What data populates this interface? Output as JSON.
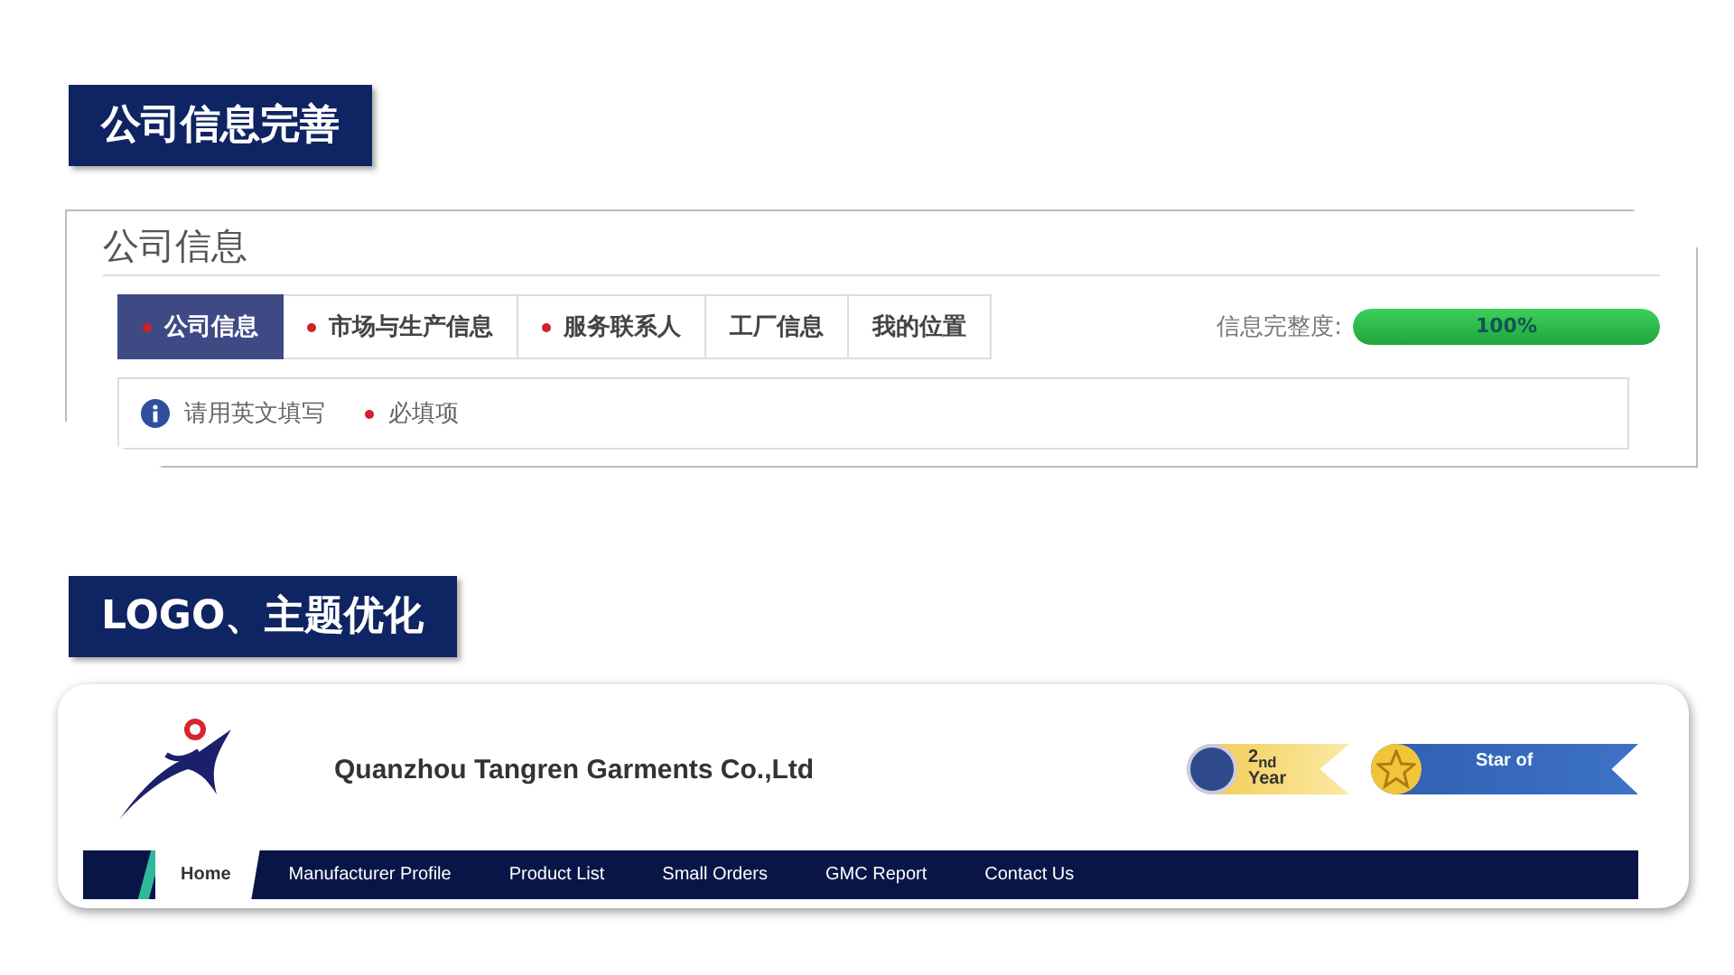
{
  "sections": [
    {
      "heading": "公司信息完善"
    },
    {
      "heading": "LOGO、主题优化"
    }
  ],
  "company_info": {
    "title": "公司信息",
    "tabs": [
      {
        "label": "公司信息",
        "required": true,
        "selected": true
      },
      {
        "label": "市场与生产信息",
        "required": true,
        "selected": false
      },
      {
        "label": "服务联系人",
        "required": true,
        "selected": false
      },
      {
        "label": "工厂信息",
        "required": false,
        "selected": false
      },
      {
        "label": "我的位置",
        "required": false,
        "selected": false
      }
    ],
    "completeness": {
      "label": "信息完整度:",
      "level": 1,
      "reading": "100%"
    },
    "notes": [
      {
        "kind": "info",
        "text": "请用英文填写"
      },
      {
        "kind": "required",
        "text": "必填项"
      }
    ]
  },
  "storefront": {
    "company_name": "Quanzhou Tangren Garments Co.,Ltd",
    "badges": [
      {
        "kind": "year",
        "text": "2$_{nd}$ Year"
      },
      {
        "kind": "star",
        "text": "Star of"
      }
    ],
    "nav": [
      {
        "label": "Home",
        "selected": true
      },
      {
        "label": "Manufacturer Profile",
        "selected": false
      },
      {
        "label": "Product List",
        "selected": false
      },
      {
        "label": "Small Orders",
        "selected": false
      },
      {
        "label": "GMC Report",
        "selected": false
      },
      {
        "label": "Contact Us",
        "selected": false
      }
    ]
  }
}
